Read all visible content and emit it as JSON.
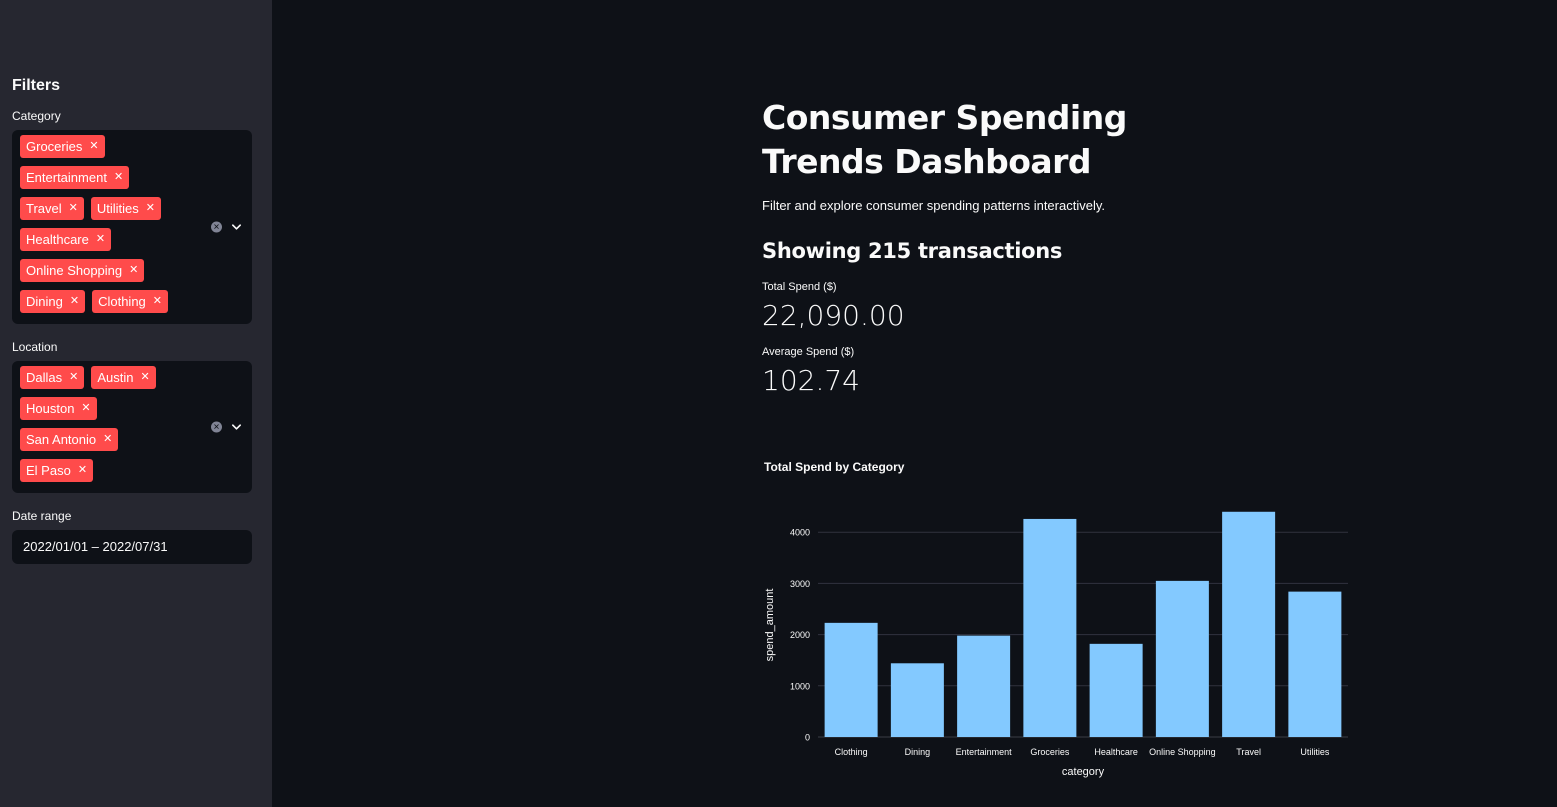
{
  "sidebar": {
    "title": "Filters",
    "category": {
      "label": "Category",
      "selected": [
        "Groceries",
        "Entertainment",
        "Travel",
        "Utilities",
        "Healthcare",
        "Online Shopping",
        "Dining",
        "Clothing"
      ]
    },
    "location": {
      "label": "Location",
      "selected": [
        "Dallas",
        "Austin",
        "Houston",
        "San Antonio",
        "El Paso"
      ]
    },
    "date_range": {
      "label": "Date range",
      "value": "2022/01/01 – 2022/07/31"
    }
  },
  "main": {
    "title": "Consumer Spending Trends Dashboard",
    "caption": "Filter and explore consumer spending patterns interactively.",
    "subheader": "Showing 215 transactions",
    "metrics": [
      {
        "label": "Total Spend ($)",
        "value": "22,090.00"
      },
      {
        "label": "Average Spend ($)",
        "value": "102.74"
      }
    ]
  },
  "colors": {
    "accent": "#ff4b4b",
    "bar": "#83c9ff",
    "sidebar_bg": "#262730",
    "main_bg": "#0e1117"
  },
  "chart_data": {
    "type": "bar",
    "title": "Total Spend by Category",
    "xlabel": "category",
    "ylabel": "spend_amount",
    "categories": [
      "Clothing",
      "Dining",
      "Entertainment",
      "Groceries",
      "Healthcare",
      "Online Shopping",
      "Travel",
      "Utilities"
    ],
    "values": [
      2230,
      1440,
      1980,
      4260,
      1820,
      3050,
      4400,
      2840
    ],
    "yticks": [
      0,
      1000,
      2000,
      3000,
      4000
    ],
    "ylim": [
      0,
      4630
    ],
    "grid": true
  }
}
